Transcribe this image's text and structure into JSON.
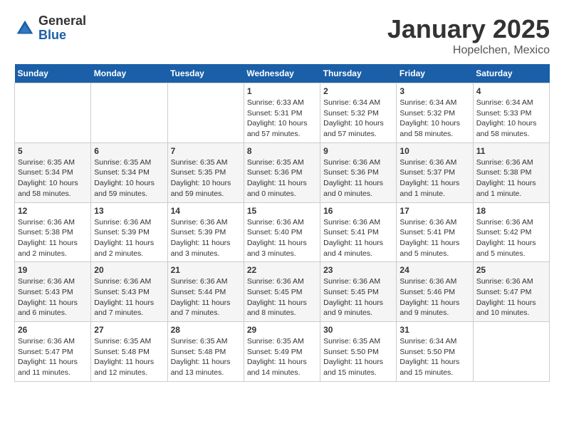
{
  "logo": {
    "general": "General",
    "blue": "Blue"
  },
  "title": "January 2025",
  "subtitle": "Hopelchen, Mexico",
  "weekdays": [
    "Sunday",
    "Monday",
    "Tuesday",
    "Wednesday",
    "Thursday",
    "Friday",
    "Saturday"
  ],
  "weeks": [
    [
      {
        "day": "",
        "info": ""
      },
      {
        "day": "",
        "info": ""
      },
      {
        "day": "",
        "info": ""
      },
      {
        "day": "1",
        "info": "Sunrise: 6:33 AM\nSunset: 5:31 PM\nDaylight: 10 hours\nand 57 minutes."
      },
      {
        "day": "2",
        "info": "Sunrise: 6:34 AM\nSunset: 5:32 PM\nDaylight: 10 hours\nand 57 minutes."
      },
      {
        "day": "3",
        "info": "Sunrise: 6:34 AM\nSunset: 5:32 PM\nDaylight: 10 hours\nand 58 minutes."
      },
      {
        "day": "4",
        "info": "Sunrise: 6:34 AM\nSunset: 5:33 PM\nDaylight: 10 hours\nand 58 minutes."
      }
    ],
    [
      {
        "day": "5",
        "info": "Sunrise: 6:35 AM\nSunset: 5:34 PM\nDaylight: 10 hours\nand 58 minutes."
      },
      {
        "day": "6",
        "info": "Sunrise: 6:35 AM\nSunset: 5:34 PM\nDaylight: 10 hours\nand 59 minutes."
      },
      {
        "day": "7",
        "info": "Sunrise: 6:35 AM\nSunset: 5:35 PM\nDaylight: 10 hours\nand 59 minutes."
      },
      {
        "day": "8",
        "info": "Sunrise: 6:35 AM\nSunset: 5:36 PM\nDaylight: 11 hours\nand 0 minutes."
      },
      {
        "day": "9",
        "info": "Sunrise: 6:36 AM\nSunset: 5:36 PM\nDaylight: 11 hours\nand 0 minutes."
      },
      {
        "day": "10",
        "info": "Sunrise: 6:36 AM\nSunset: 5:37 PM\nDaylight: 11 hours\nand 1 minute."
      },
      {
        "day": "11",
        "info": "Sunrise: 6:36 AM\nSunset: 5:38 PM\nDaylight: 11 hours\nand 1 minute."
      }
    ],
    [
      {
        "day": "12",
        "info": "Sunrise: 6:36 AM\nSunset: 5:38 PM\nDaylight: 11 hours\nand 2 minutes."
      },
      {
        "day": "13",
        "info": "Sunrise: 6:36 AM\nSunset: 5:39 PM\nDaylight: 11 hours\nand 2 minutes."
      },
      {
        "day": "14",
        "info": "Sunrise: 6:36 AM\nSunset: 5:39 PM\nDaylight: 11 hours\nand 3 minutes."
      },
      {
        "day": "15",
        "info": "Sunrise: 6:36 AM\nSunset: 5:40 PM\nDaylight: 11 hours\nand 3 minutes."
      },
      {
        "day": "16",
        "info": "Sunrise: 6:36 AM\nSunset: 5:41 PM\nDaylight: 11 hours\nand 4 minutes."
      },
      {
        "day": "17",
        "info": "Sunrise: 6:36 AM\nSunset: 5:41 PM\nDaylight: 11 hours\nand 5 minutes."
      },
      {
        "day": "18",
        "info": "Sunrise: 6:36 AM\nSunset: 5:42 PM\nDaylight: 11 hours\nand 5 minutes."
      }
    ],
    [
      {
        "day": "19",
        "info": "Sunrise: 6:36 AM\nSunset: 5:43 PM\nDaylight: 11 hours\nand 6 minutes."
      },
      {
        "day": "20",
        "info": "Sunrise: 6:36 AM\nSunset: 5:43 PM\nDaylight: 11 hours\nand 7 minutes."
      },
      {
        "day": "21",
        "info": "Sunrise: 6:36 AM\nSunset: 5:44 PM\nDaylight: 11 hours\nand 7 minutes."
      },
      {
        "day": "22",
        "info": "Sunrise: 6:36 AM\nSunset: 5:45 PM\nDaylight: 11 hours\nand 8 minutes."
      },
      {
        "day": "23",
        "info": "Sunrise: 6:36 AM\nSunset: 5:45 PM\nDaylight: 11 hours\nand 9 minutes."
      },
      {
        "day": "24",
        "info": "Sunrise: 6:36 AM\nSunset: 5:46 PM\nDaylight: 11 hours\nand 9 minutes."
      },
      {
        "day": "25",
        "info": "Sunrise: 6:36 AM\nSunset: 5:47 PM\nDaylight: 11 hours\nand 10 minutes."
      }
    ],
    [
      {
        "day": "26",
        "info": "Sunrise: 6:36 AM\nSunset: 5:47 PM\nDaylight: 11 hours\nand 11 minutes."
      },
      {
        "day": "27",
        "info": "Sunrise: 6:35 AM\nSunset: 5:48 PM\nDaylight: 11 hours\nand 12 minutes."
      },
      {
        "day": "28",
        "info": "Sunrise: 6:35 AM\nSunset: 5:48 PM\nDaylight: 11 hours\nand 13 minutes."
      },
      {
        "day": "29",
        "info": "Sunrise: 6:35 AM\nSunset: 5:49 PM\nDaylight: 11 hours\nand 14 minutes."
      },
      {
        "day": "30",
        "info": "Sunrise: 6:35 AM\nSunset: 5:50 PM\nDaylight: 11 hours\nand 15 minutes."
      },
      {
        "day": "31",
        "info": "Sunrise: 6:34 AM\nSunset: 5:50 PM\nDaylight: 11 hours\nand 15 minutes."
      },
      {
        "day": "",
        "info": ""
      }
    ]
  ]
}
